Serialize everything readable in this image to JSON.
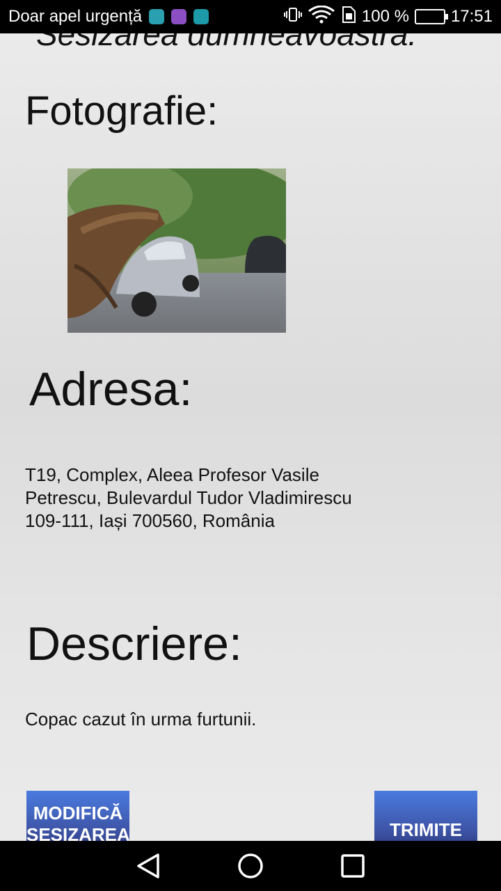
{
  "status_bar": {
    "carrier": "Doar apel urgență",
    "battery": "100 %",
    "time": "17:51"
  },
  "page": {
    "top_title": "Sesizarea dumneavoastră:",
    "photo_heading": "Fotografie:",
    "address_heading": "Adresa:",
    "address_lines": [
      "T19, Complex, Aleea Profesor Vasile",
      "Petrescu, Bulevardul Tudor Vladimirescu",
      "109-111, Iași 700560, România"
    ],
    "description_heading": "Descriere:",
    "description": "Copac cazut în urma furtunii."
  },
  "buttons": {
    "modify_line1": "MODIFICĂ",
    "modify_line2": "SESIZAREA",
    "send": "TRIMITE"
  },
  "colors": {
    "button": "#3e55a8",
    "battery": "#5cc63a"
  },
  "icons": {
    "nav": [
      "back-icon",
      "home-icon",
      "recents-icon"
    ]
  }
}
